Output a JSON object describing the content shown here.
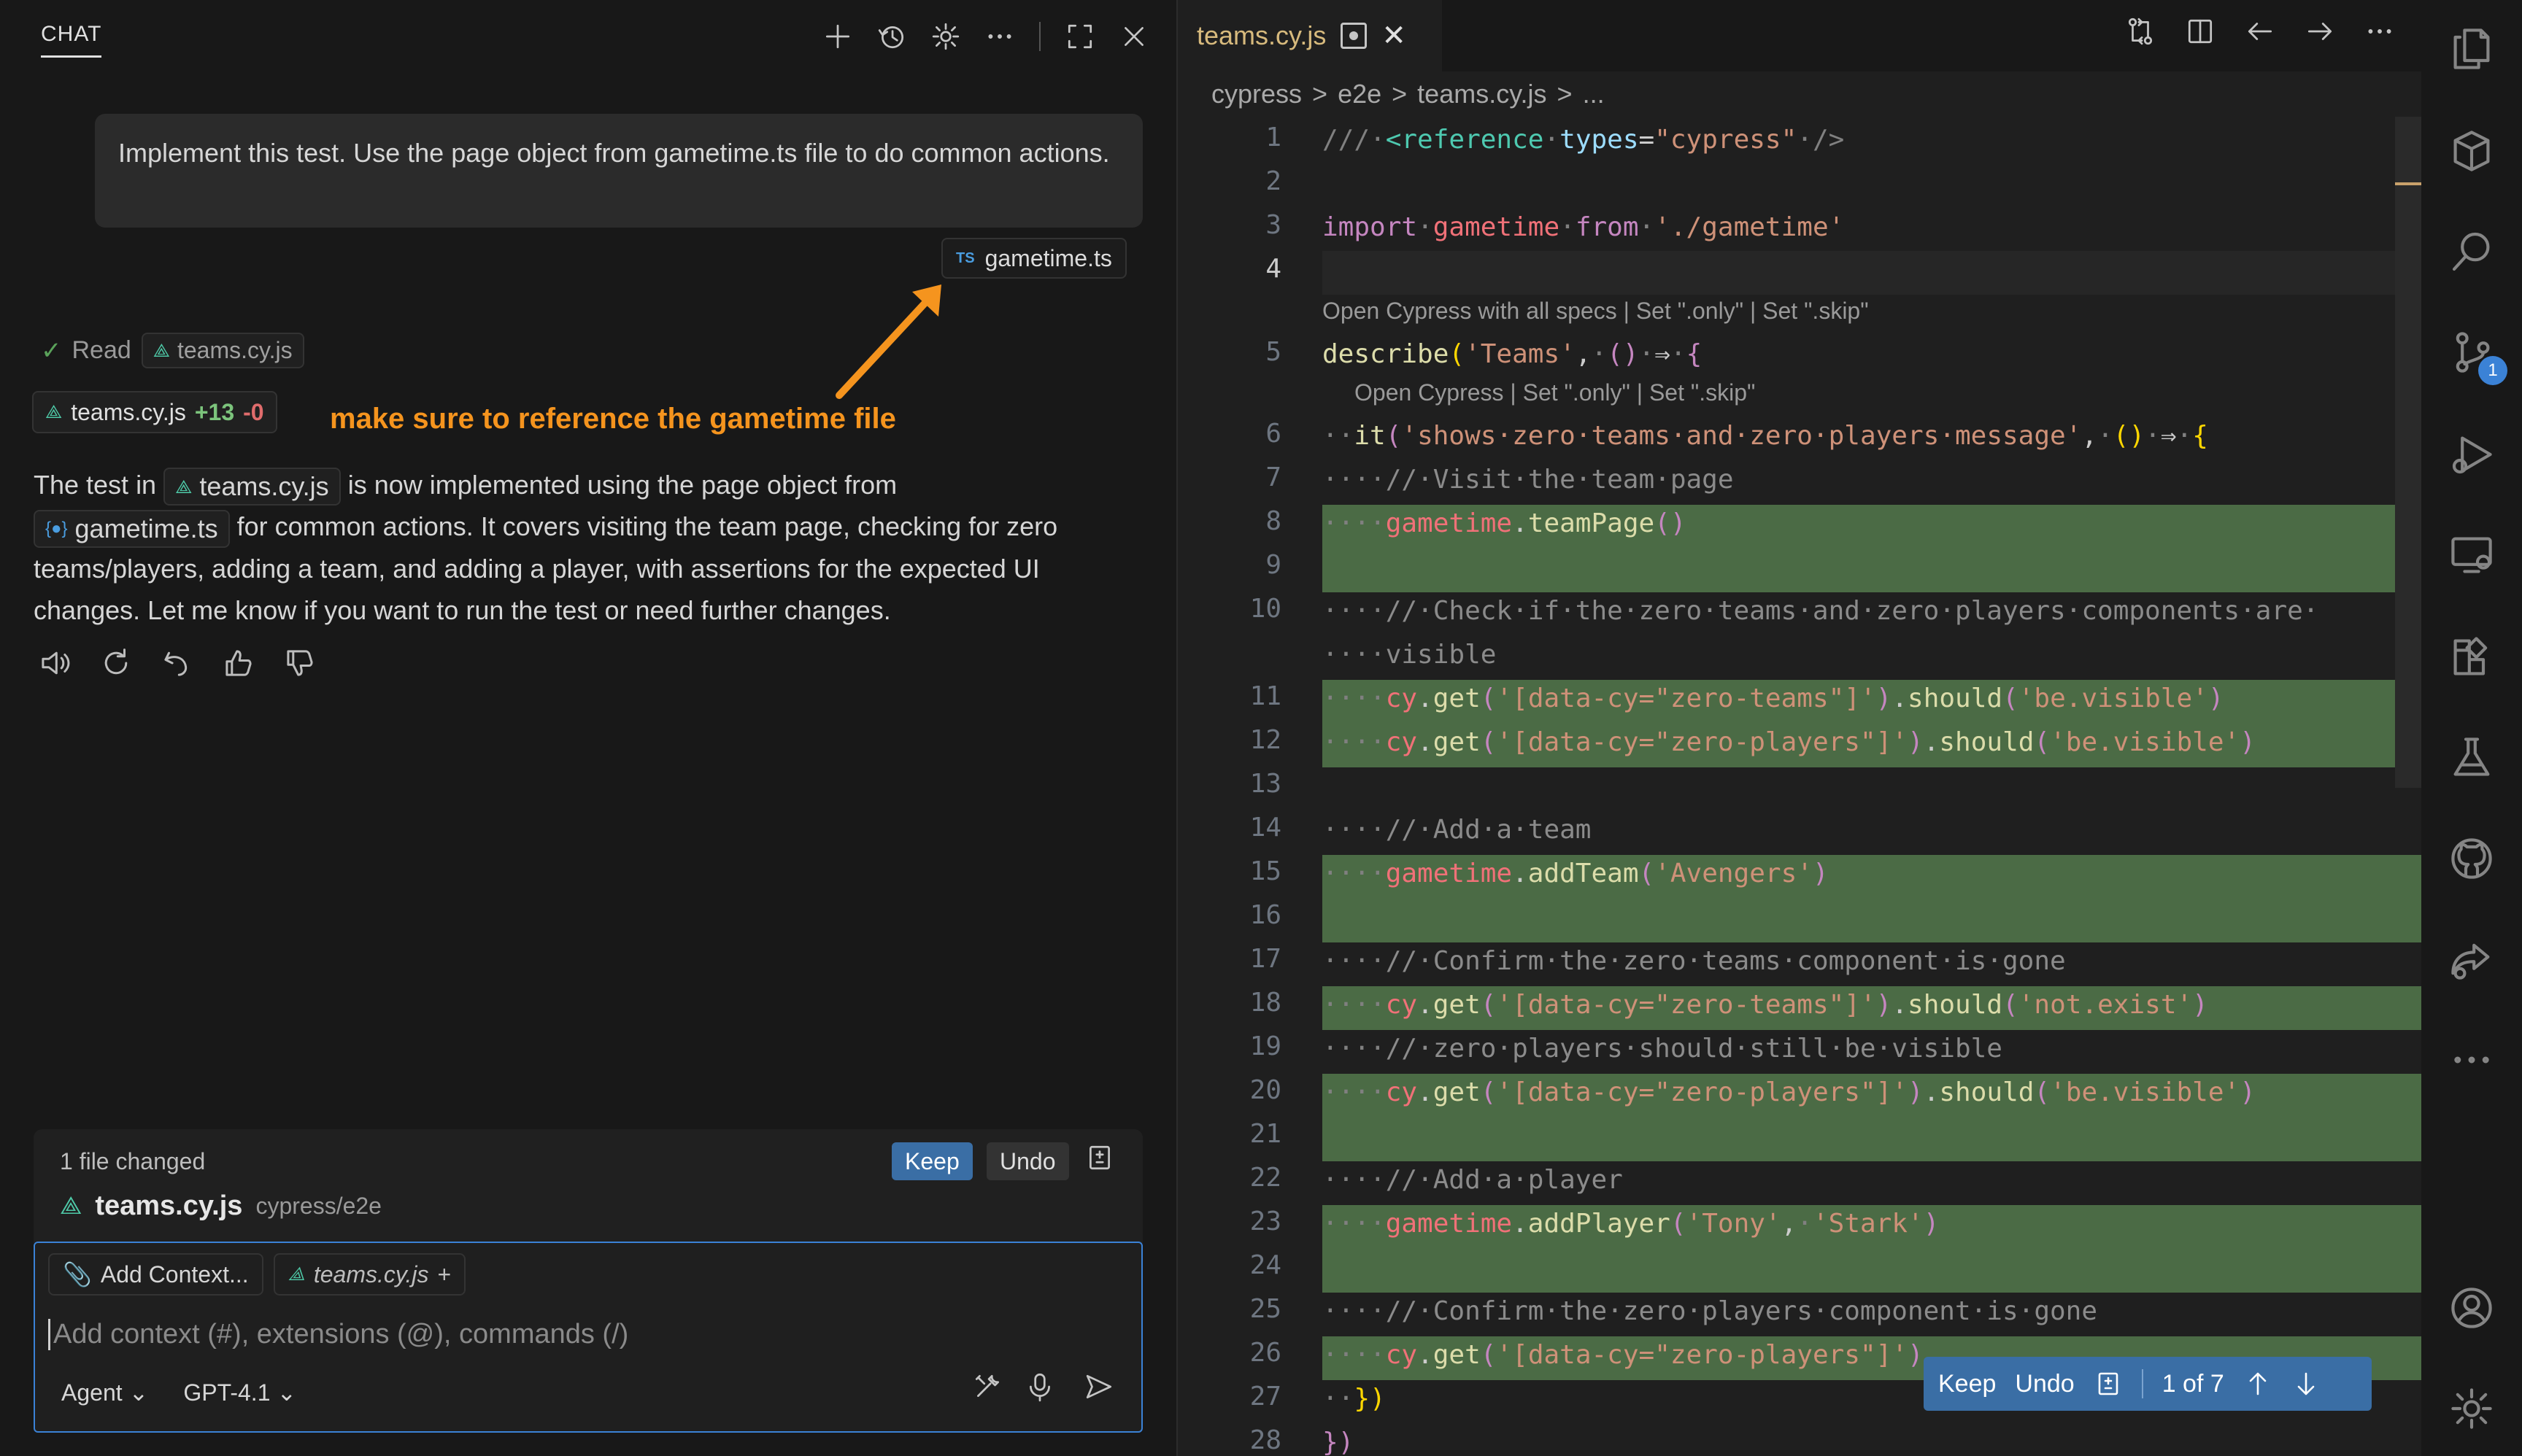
{
  "chat": {
    "title": "CHAT",
    "user_message": "Implement this test. Use the page object from gametime.ts file to do common actions.",
    "attachment": {
      "badge": "TS",
      "name": "gametime.ts"
    },
    "read_label": "Read",
    "read_file": "teams.cy.js",
    "diff_file": "teams.cy.js",
    "diff_added": "+13",
    "diff_removed": "-0",
    "annotation": "make sure to reference the gametime file",
    "response": {
      "p1": "The test in",
      "file1": "teams.cy.js",
      "p2": "is now implemented using the page object from",
      "file2": "gametime.ts",
      "p3": "for common actions. It covers visiting the team page, checking for zero teams/players, adding a team, and adding a player, with assertions for the expected UI changes. Let me know if you want to run the test or need further changes."
    },
    "changes": {
      "count": "1 file changed",
      "keep": "Keep",
      "undo": "Undo",
      "file_name": "teams.cy.js",
      "file_path": "cypress/e2e"
    },
    "input": {
      "add_context": "Add Context...",
      "context_file": "teams.cy.js",
      "placeholder": "Add context (#), extensions (@), commands (/)",
      "mode": "Agent",
      "model": "GPT-4.1"
    }
  },
  "editor": {
    "tab_name": "teams.cy.js",
    "breadcrumb": [
      "cypress",
      ">",
      "e2e",
      ">",
      "teams.cy.js",
      ">",
      "..."
    ],
    "codelens_describe": "Open Cypress with all specs | Set \".only\" | Set \".skip\"",
    "codelens_it": "Open Cypress | Set \".only\" | Set \".skip\"",
    "line_numbers": [
      "1",
      "2",
      "3",
      "4",
      "5",
      "6",
      "7",
      "8",
      "9",
      "10",
      "",
      "11",
      "12",
      "13",
      "14",
      "15",
      "16",
      "17",
      "18",
      "19",
      "20",
      "21",
      "22",
      "23",
      "24",
      "25",
      "26",
      "27",
      "28"
    ],
    "diff_toolbar": {
      "keep": "Keep",
      "undo": "Undo",
      "position": "1 of 7"
    }
  },
  "activity_bar": {
    "icons": [
      "explorer-icon",
      "extensions-box-icon",
      "search-icon",
      "source-control-icon",
      "run-debug-icon",
      "remote-explorer-icon",
      "extensions-icon",
      "testing-flask-icon",
      "github-icon",
      "live-share-icon",
      "more-icon",
      "account-icon",
      "settings-gear-icon"
    ],
    "source_control_badge": "1"
  },
  "colors": {
    "accent": "#3b82d6",
    "added_line": "#4b6b45",
    "annotation": "#f5941e"
  }
}
